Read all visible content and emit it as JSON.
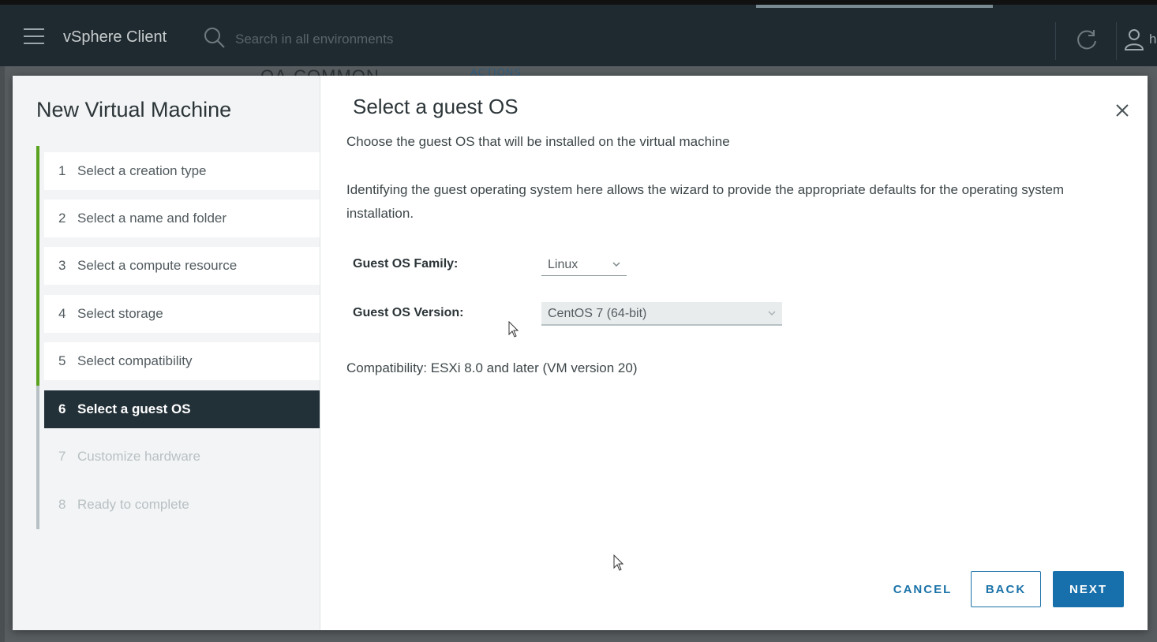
{
  "header": {
    "app_title": "vSphere Client",
    "search_placeholder": "Search in all environments",
    "user_text": "h"
  },
  "background": {
    "breadcrumb": "QA-COMMON",
    "actions_label": "ACTIONS"
  },
  "wizard": {
    "title": "New Virtual Machine",
    "steps": [
      {
        "num": "1",
        "label": "Select a creation type",
        "state": "done"
      },
      {
        "num": "2",
        "label": "Select a name and folder",
        "state": "done"
      },
      {
        "num": "3",
        "label": "Select a compute resource",
        "state": "done"
      },
      {
        "num": "4",
        "label": "Select storage",
        "state": "done"
      },
      {
        "num": "5",
        "label": "Select compatibility",
        "state": "done"
      },
      {
        "num": "6",
        "label": "Select a guest OS",
        "state": "active"
      },
      {
        "num": "7",
        "label": "Customize hardware",
        "state": "disabled"
      },
      {
        "num": "8",
        "label": "Ready to complete",
        "state": "disabled"
      }
    ]
  },
  "page": {
    "title": "Select a guest OS",
    "subtitle": "Choose the guest OS that will be installed on the virtual machine",
    "description": "Identifying the guest operating system here allows the wizard to provide the appropriate defaults for the operating system installation.",
    "family_label": "Guest OS Family:",
    "family_value": "Linux",
    "version_label": "Guest OS Version:",
    "version_value": "CentOS 7 (64-bit)",
    "compatibility": "Compatibility: ESXi 8.0 and later (VM version 20)"
  },
  "buttons": {
    "cancel": "CANCEL",
    "back": "BACK",
    "next": "NEXT"
  },
  "colors": {
    "accent": "#1770ab",
    "step_done": "#5aa220",
    "active_step_bg": "#223038"
  }
}
